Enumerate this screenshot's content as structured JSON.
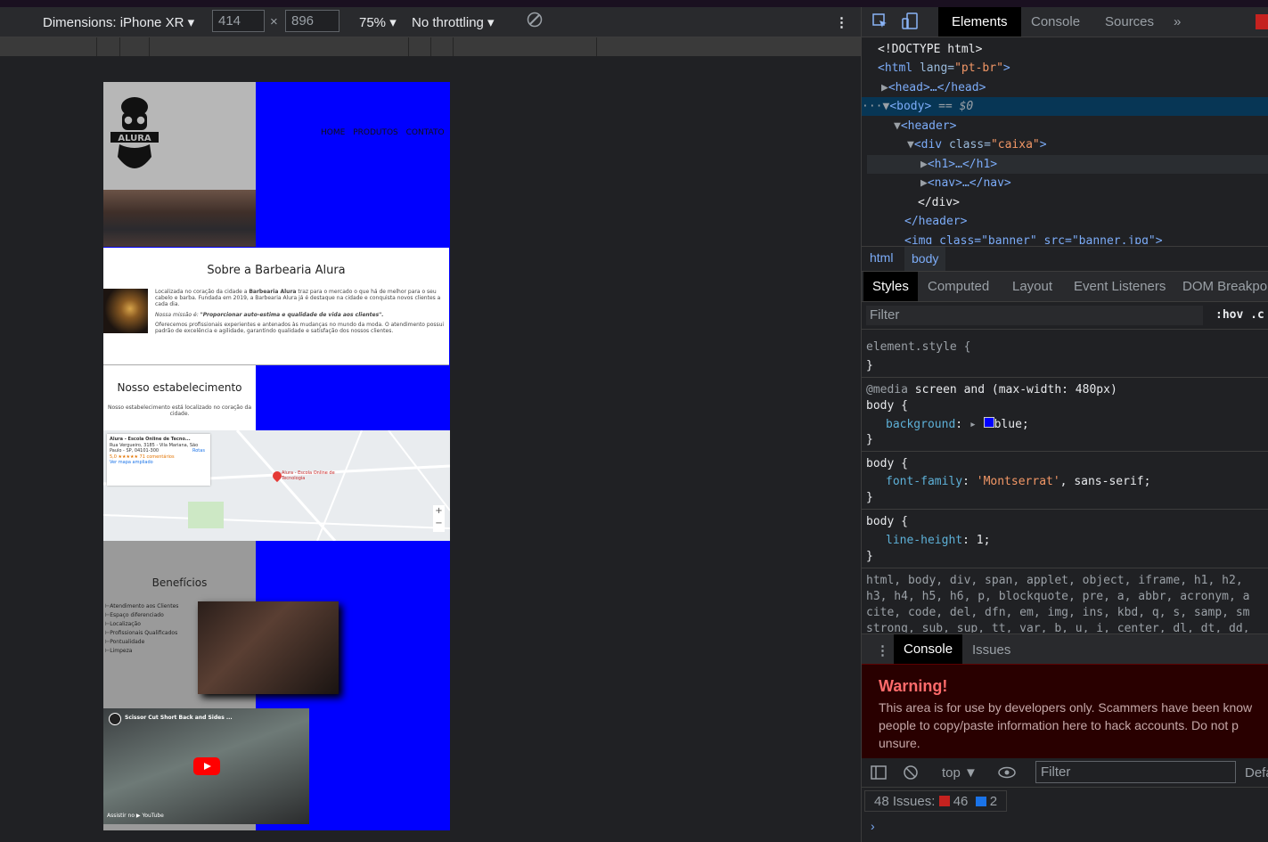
{
  "device_toolbar": {
    "dimensions_label": "Dimensions: iPhone XR",
    "width_value": "414",
    "height_value": "896",
    "times": "×",
    "zoom": "75%",
    "throttling": "No throttling",
    "more": "⋮"
  },
  "site": {
    "logo_text": "ALURA",
    "nav": [
      "HOME",
      "PRODUTOS",
      "CONTATO"
    ],
    "sobre": {
      "title": "Sobre a Barbearia Alura",
      "p1_start": "Localizada no coração da cidade a ",
      "p1_bold": "Barbearia Alura",
      "p1_end": " traz para o mercado o que há de melhor para o seu cabelo e barba. Fundada em 2019, a Barbearia Alura já é destaque na cidade e conquista novos clientes a cada dia.",
      "p2_start": "Nossa missão é: ",
      "p2_bold": "\"Proporcionar auto-estima e qualidade de vida aos clientes\".",
      "p3": "Oferecemos profissionais experientes e antenados às mudanças no mundo da moda. O atendimento possui padrão de excelência e agilidade, garantindo qualidade e satisfação dos nossos clientes."
    },
    "estab": {
      "title": "Nosso estabelecimento",
      "text": "Nosso estabelecimento está localizado no coração da cidade."
    },
    "map": {
      "card_title": "Alura - Escola Online de Tecno...",
      "card_address": "Rua Vergueiro, 3185 - Vila Mariana, São Paulo - SP, 04101-300",
      "card_rating": "5,0 ★★★★★  71 comentários",
      "card_link": "Ver mapa ampliado",
      "routes": "Rotas",
      "pin_label": "Alura - Escola Online de Tecnologia",
      "zoom_in": "+",
      "zoom_out": "−"
    },
    "beneficios": {
      "title": "Benefícios",
      "items": [
        "Atendimento aos Clientes",
        "Espaço diferenciado",
        "Localização",
        "Profissionais Qualificados",
        "Pontualidade",
        "Limpeza"
      ]
    },
    "video": {
      "title": "Scissor Cut Short Back and Sides ...",
      "watch": "Assistir no ▶ YouTube"
    }
  },
  "devtools": {
    "tabs": [
      "Elements",
      "Console",
      "Sources",
      "»"
    ],
    "tree": {
      "doctype": "<!DOCTYPE html>",
      "html_tag": "<html",
      "html_attr": " lang=",
      "html_val": "\"pt-br\"",
      "html_close": ">",
      "head": "<head>…</head>",
      "body": "<body>",
      "body_eq": " == $0",
      "header": "<header>",
      "div_open": "<div",
      "div_attr": " class=",
      "div_val": "\"caixa\"",
      "div_close": ">",
      "h1": "<h1>…</h1>",
      "nav": "<nav>…</nav>",
      "div_end": "</div>",
      "header_end": "</header>",
      "img": "<img class=\"banner\" src=\"banner.jpg\">"
    },
    "breadcrumbs": [
      "html",
      "body"
    ],
    "style_tabs": [
      "Styles",
      "Computed",
      "Layout",
      "Event Listeners",
      "DOM Breakpoi"
    ],
    "filter_placeholder": "Filter",
    "hov": ":hov  .c",
    "rules": {
      "element_style": "element.style {",
      "close": "}",
      "media": "@media",
      "media_q": " screen and (max-width: 480px)",
      "body_sel": "body {",
      "bg_prop": "background",
      "bg_val": "blue;",
      "ff_prop": "font-family",
      "ff_str": "'Montserrat'",
      "ff_rest": ", sans-serif;",
      "lh_prop": "line-height",
      "lh_val": "1;",
      "reset1": "html, body, div, span, applet, object, iframe, h1, h2,",
      "reset2": "h3, h4, h5, h6, p, blockquote, pre, a, abbr, acronym, a",
      "reset3": "cite, code, del, dfn, em, img, ins, kbd, q, s, samp, sm",
      "reset4": "strong, sub, sup, tt, var, b, u, i, center, dl, dt, dd,"
    },
    "drawer_tabs": [
      "Console",
      "Issues"
    ],
    "warning": {
      "title": "Warning!",
      "l1": "This area is for use by developers only. Scammers have been know",
      "l2": "people to copy/paste information here to hack accounts. Do not p",
      "l3": "unsure."
    },
    "console_toolbar": {
      "context": "top ▼",
      "filter": "Filter",
      "levels": "Defa"
    },
    "issues": {
      "label": "48 Issues:",
      "errors": "46",
      "info": "2"
    },
    "prompt": "›"
  },
  "colors": {
    "page_bg": "#0000ff",
    "devtools_bg": "#202124",
    "warning_bg": "#290000"
  }
}
